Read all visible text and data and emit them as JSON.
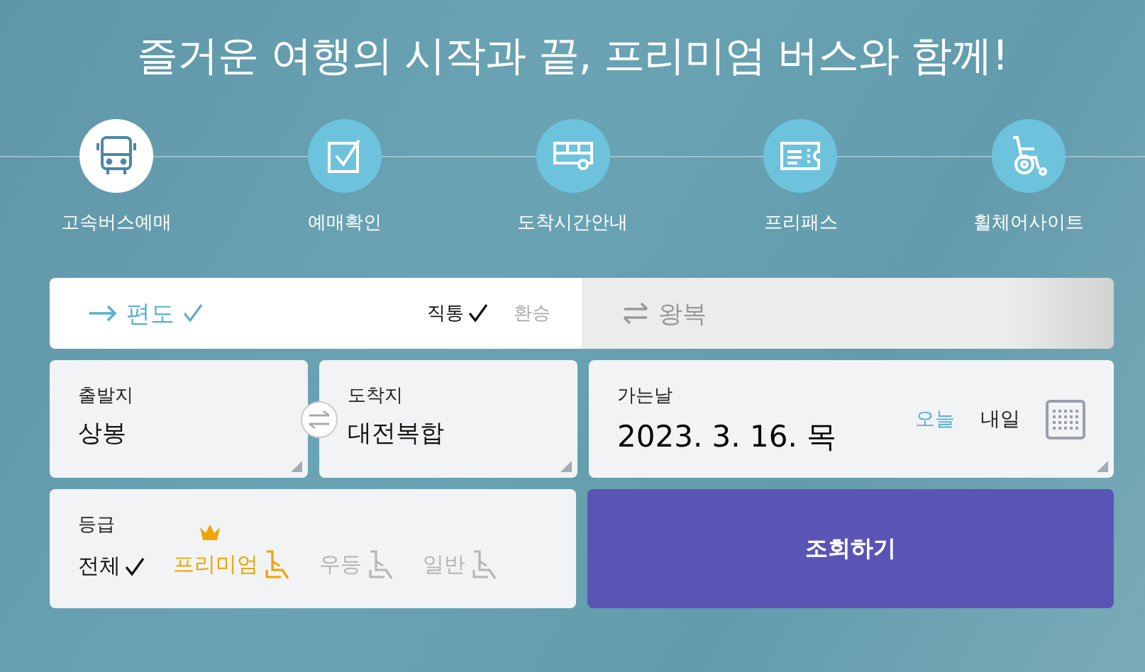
{
  "headline": "즐거운 여행의 시작과 끝, 프리미엄 버스와 함께!",
  "nav": [
    {
      "label": "고속버스예매",
      "kind": "bus",
      "selected": true
    },
    {
      "label": "예매확인",
      "kind": "check",
      "selected": false
    },
    {
      "label": "도착시간안내",
      "kind": "arrival",
      "selected": false
    },
    {
      "label": "프리패스",
      "kind": "ticket",
      "selected": false
    },
    {
      "label": "휠체어사이트",
      "kind": "wheelchair",
      "selected": false
    }
  ],
  "trip_types": [
    {
      "label": "편도",
      "kind": "oneway",
      "selected": true
    },
    {
      "label": "왕복",
      "kind": "round",
      "selected": false
    }
  ],
  "route_options": [
    {
      "label": "직통",
      "selected": true
    },
    {
      "label": "환승",
      "selected": false
    }
  ],
  "departure": {
    "label": "출발지",
    "value": "상봉"
  },
  "arrival": {
    "label": "도착지",
    "value": "대전복합"
  },
  "date": {
    "label": "가는날",
    "value": "2023. 3. 16. 목",
    "quick": [
      {
        "label": "오늘",
        "selected": true
      },
      {
        "label": "내일",
        "selected": false
      }
    ]
  },
  "grade": {
    "label": "등급",
    "options": [
      {
        "label": "전체",
        "kind": "all",
        "selected": true
      },
      {
        "label": "프리미엄",
        "kind": "premium",
        "selected": false
      },
      {
        "label": "우등",
        "kind": "deluxe",
        "selected": false
      },
      {
        "label": "일반",
        "kind": "standard",
        "selected": false
      }
    ]
  },
  "search_button": "조회하기"
}
